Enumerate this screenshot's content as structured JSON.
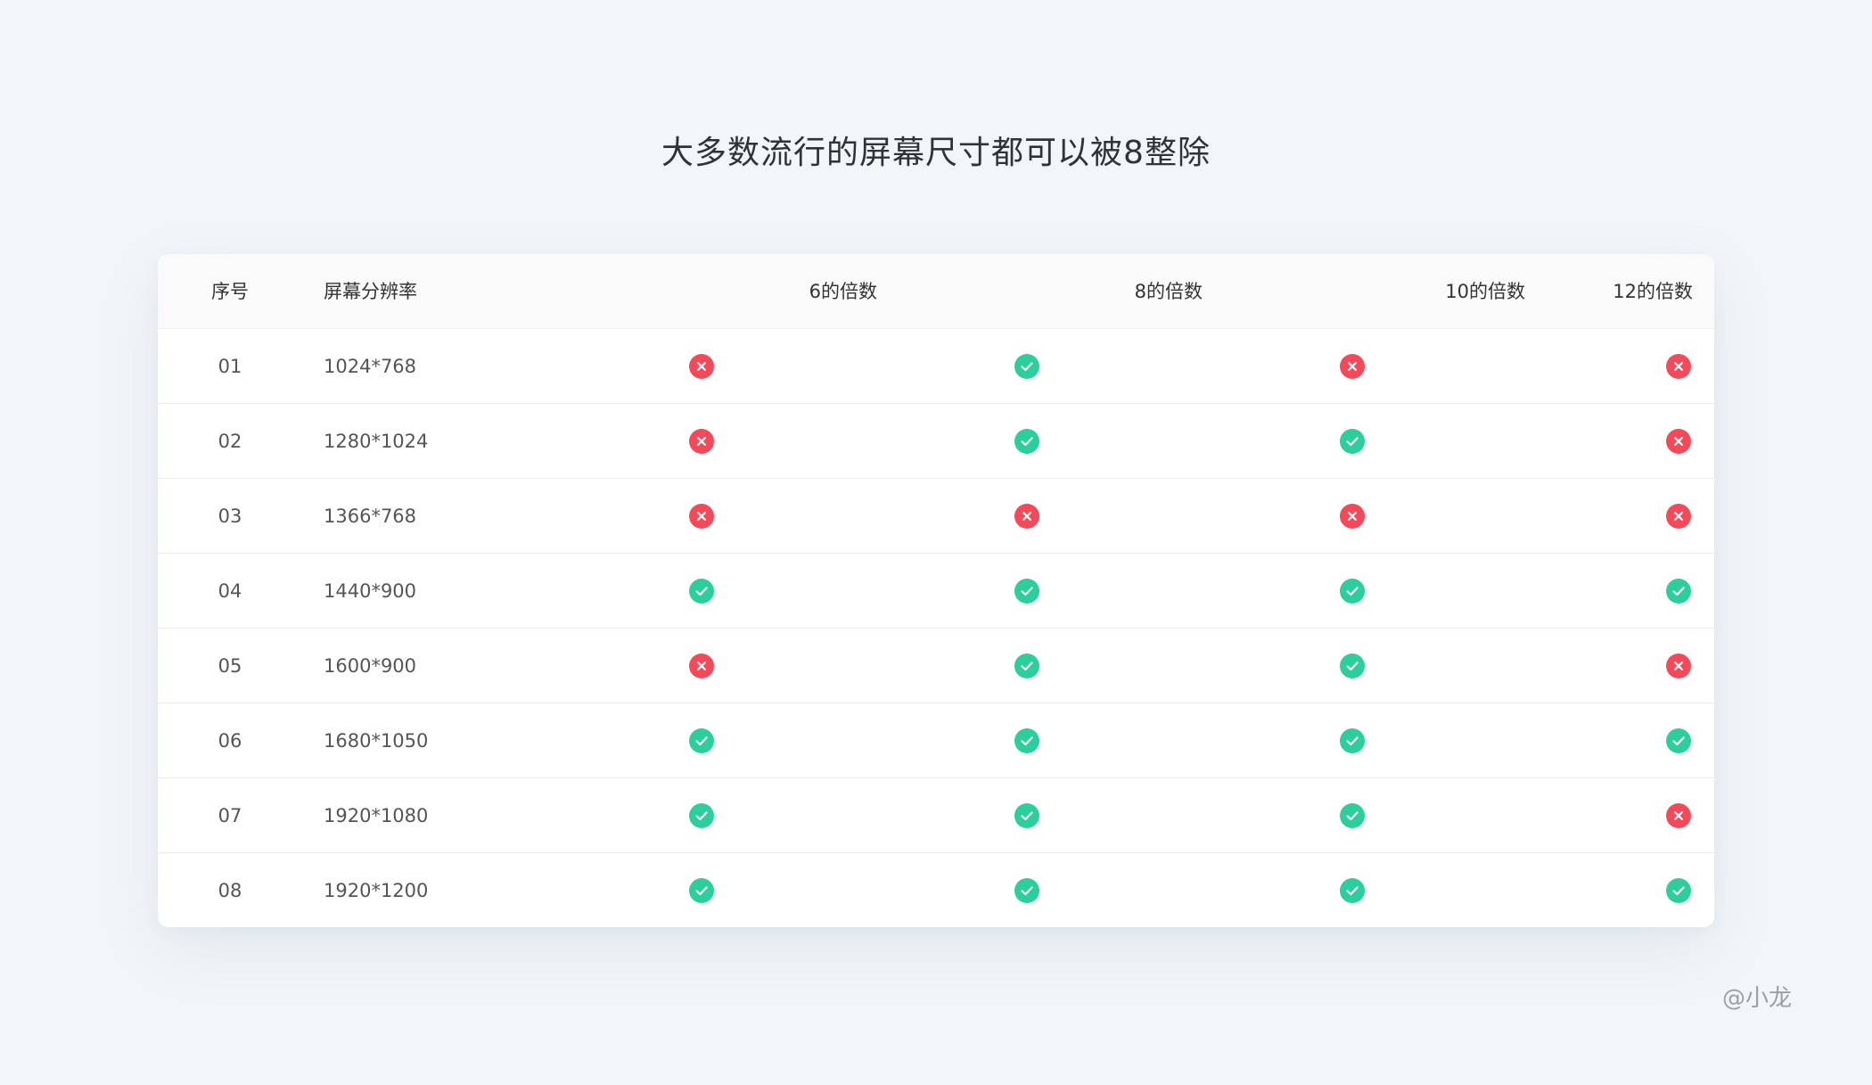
{
  "title": "大多数流行的屏幕尺寸都可以被8整除",
  "table": {
    "headers": {
      "index": "序号",
      "resolution": "屏幕分辨率",
      "mult6": "6的倍数",
      "mult8": "8的倍数",
      "mult10": "10的倍数",
      "mult12": "12的倍数"
    },
    "rows": [
      {
        "index": "01",
        "resolution": "1024*768",
        "mult6": false,
        "mult8": true,
        "mult10": false,
        "mult12": false
      },
      {
        "index": "02",
        "resolution": "1280*1024",
        "mult6": false,
        "mult8": true,
        "mult10": true,
        "mult12": false
      },
      {
        "index": "03",
        "resolution": "1366*768",
        "mult6": false,
        "mult8": false,
        "mult10": false,
        "mult12": false
      },
      {
        "index": "04",
        "resolution": "1440*900",
        "mult6": true,
        "mult8": true,
        "mult10": true,
        "mult12": true
      },
      {
        "index": "05",
        "resolution": "1600*900",
        "mult6": false,
        "mult8": true,
        "mult10": true,
        "mult12": false
      },
      {
        "index": "06",
        "resolution": "1680*1050",
        "mult6": true,
        "mult8": true,
        "mult10": true,
        "mult12": true
      },
      {
        "index": "07",
        "resolution": "1920*1080",
        "mult6": true,
        "mult8": true,
        "mult10": true,
        "mult12": false
      },
      {
        "index": "08",
        "resolution": "1920*1200",
        "mult6": true,
        "mult8": true,
        "mult10": true,
        "mult12": true
      }
    ]
  },
  "watermark": "@小龙",
  "colors": {
    "yes": "#2ccf9c",
    "no": "#f5495a",
    "background": "#f2f6f9"
  },
  "icons": {
    "yes": "check-circle-icon",
    "no": "cross-circle-icon"
  }
}
